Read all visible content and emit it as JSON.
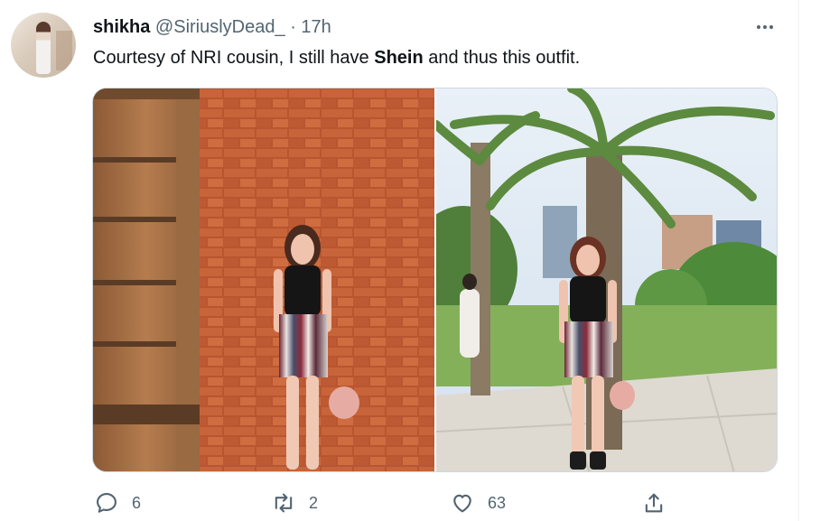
{
  "tweet": {
    "display_name": "shikha",
    "handle": "@SiriuslyDead_",
    "separator": "·",
    "time": "17h",
    "text_before": "Courtesy of NRI cousin, I still have ",
    "text_bold": "Shein",
    "text_after": " and thus this outfit."
  },
  "actions": {
    "reply_count": "6",
    "retweet_count": "2",
    "like_count": "63"
  },
  "icons": [
    "more-icon",
    "reply-icon",
    "retweet-icon",
    "like-icon",
    "share-icon"
  ],
  "colors": {
    "text": "#0f1419",
    "muted": "#536471",
    "border": "#cfd9de"
  }
}
